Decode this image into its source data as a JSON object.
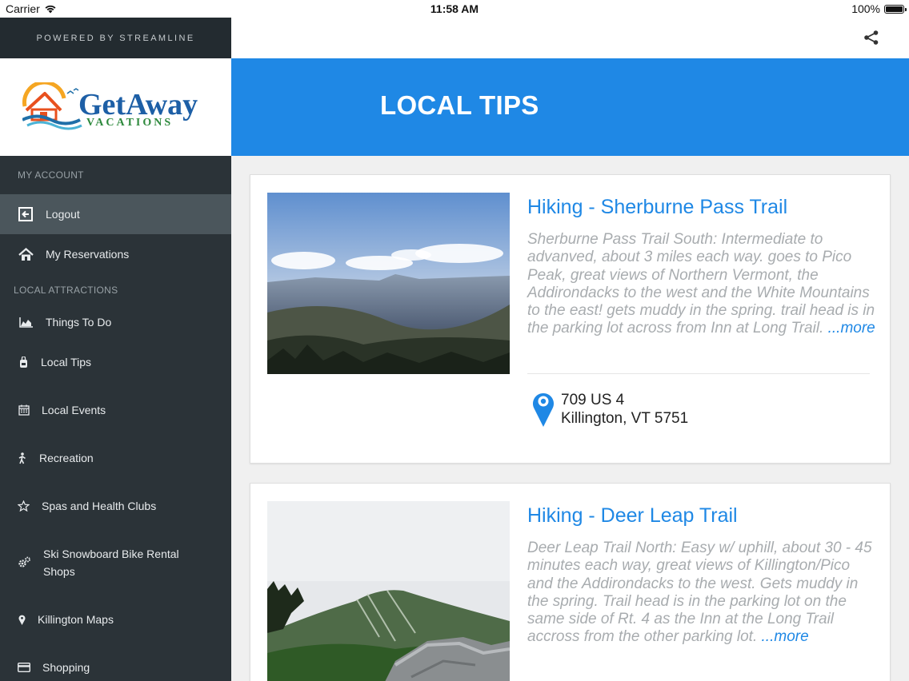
{
  "status_bar": {
    "carrier": "Carrier",
    "time": "11:58 AM",
    "battery": "100%",
    "battery_level": 1.0
  },
  "sidebar": {
    "powered_by": "POWERED BY STREAMLINE",
    "logo": {
      "word": "GetAway",
      "sub": "VACATIONS"
    },
    "section_account": "MY ACCOUNT",
    "account_items": [
      {
        "label": "Logout",
        "icon": "logout-icon"
      },
      {
        "label": "My Reservations",
        "icon": "home-icon"
      }
    ],
    "section_attractions": "LOCAL ATTRACTIONS",
    "attraction_items": [
      {
        "label": "Things To Do",
        "icon": "area-chart-icon"
      },
      {
        "label": "Local Tips",
        "icon": "backpack-icon"
      },
      {
        "label": "Local Events",
        "icon": "calendar-icon"
      },
      {
        "label": "Recreation",
        "icon": "walking-person-icon"
      },
      {
        "label": "Spas and Health Clubs",
        "icon": "star-icon"
      },
      {
        "label": "Ski Snowboard Bike Rental Shops",
        "icon": "gears-icon"
      },
      {
        "label": "Killington Maps",
        "icon": "map-pin-icon"
      },
      {
        "label": "Shopping",
        "icon": "credit-card-icon"
      }
    ]
  },
  "header": {
    "title": "LOCAL TIPS",
    "share_icon": "share-icon"
  },
  "tips": [
    {
      "title": "Hiking - Sherburne Pass Trail",
      "description": "Sherburne Pass Trail South: Intermediate to advanved, about 3 miles each way. goes to Pico Peak, great views of Northern Vermont, the Addirondacks to the west and the White Mountains to the east! gets muddy in the spring. trail head is in the parking lot across from Inn at Long Trail.",
      "more": "...more",
      "address_line1": "709 US 4",
      "address_line2": "Killington, VT 5751"
    },
    {
      "title": "Hiking - Deer Leap Trail",
      "description": "Deer Leap Trail North: Easy w/ uphill, about 30 - 45 minutes each way, great views of Killington/Pico and the Addirondacks to the west. Gets muddy in the spring. Trail head is in the parking lot on the same side of Rt. 4 as the Inn at the Long Trail accross from the other parking lot.",
      "more": "...more"
    }
  ],
  "colors": {
    "accent": "#1f88e5",
    "sidebar": "#2b3338",
    "sidebar_active": "#4b565c"
  }
}
